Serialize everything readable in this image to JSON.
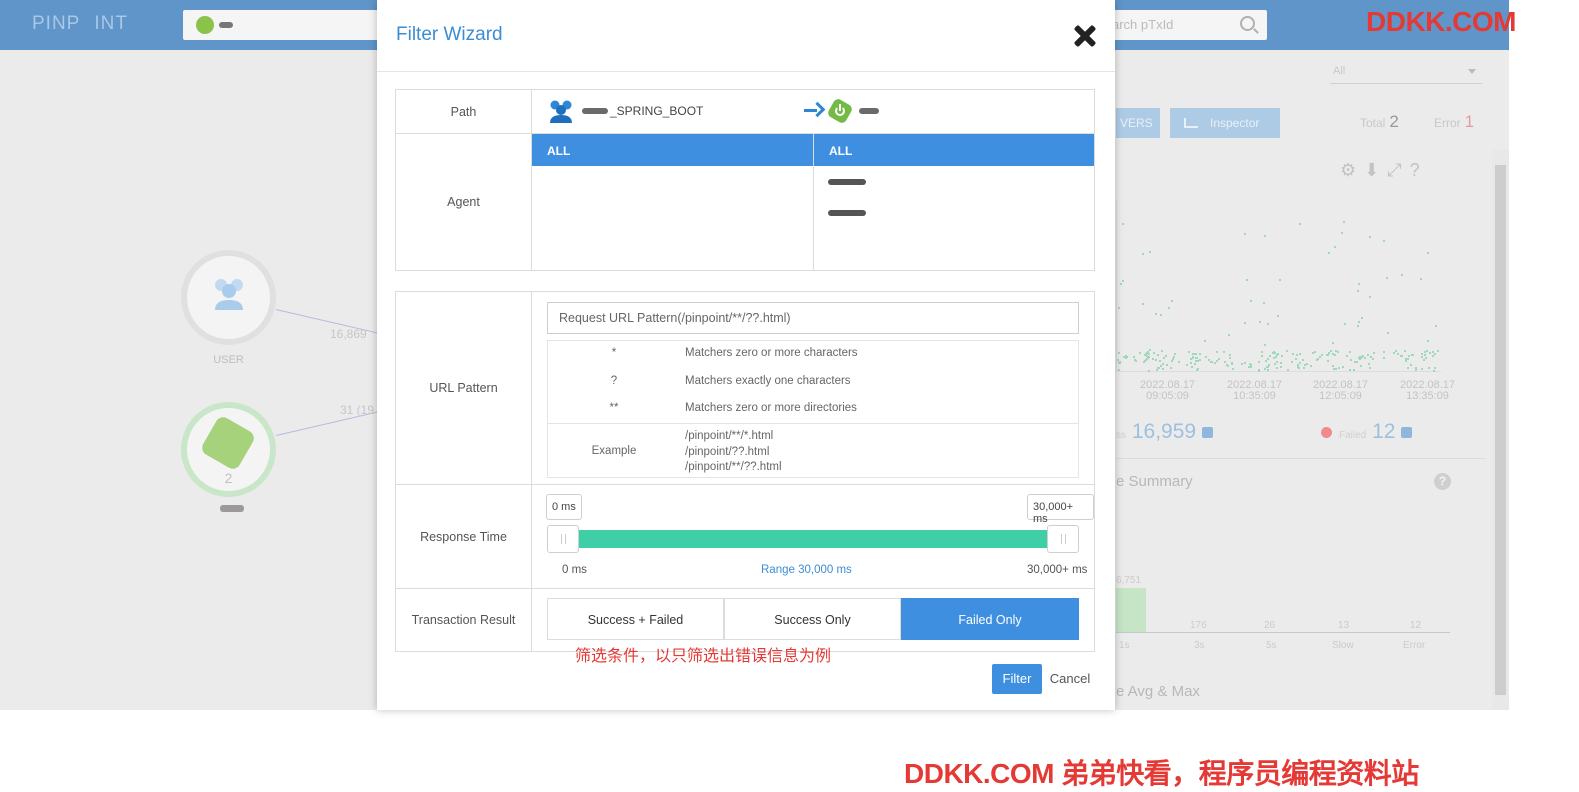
{
  "background": {
    "brand_words": [
      "PINP",
      "INT"
    ],
    "search_placeholder": "arch pTxId",
    "edge_labels": [
      "16,869",
      "31 (19"
    ],
    "user_node_label": "USER",
    "app_node_count": "2",
    "agent_select": "All",
    "servers_btn": "VERS",
    "inspector_btn": "Inspector",
    "total_label": "Total",
    "total_value": "2",
    "error_label": "Error",
    "error_value": "1",
    "x_ticks": [
      {
        "date": "2022.08.17",
        "time": "09:05:09"
      },
      {
        "date": "2022.08.17",
        "time": "10:35:09"
      },
      {
        "date": "2022.08.17",
        "time": "12:05:09"
      },
      {
        "date": "2022.08.17",
        "time": "13:35:09"
      }
    ],
    "success_label": "ss",
    "success_count": "16,959",
    "failed_label": "Failed",
    "failed_count": "12",
    "summary_title": "e Summary",
    "summary_bar_top_label": "6,751",
    "summary_values": [
      "176",
      "26",
      "13",
      "12"
    ],
    "summary_cats": [
      "1s",
      "3s",
      "5s",
      "Slow",
      "Error"
    ],
    "avgmax_title": "e Avg & Max"
  },
  "modal": {
    "title": "Filter Wizard",
    "path_label": "Path",
    "path_source_suffix": "_SPRING_BOOT",
    "agent_label": "Agent",
    "agent_all_left": "ALL",
    "agent_all_right": "ALL",
    "url_label": "URL Pattern",
    "url_placeholder": "Request URL Pattern(/pinpoint/**/??.html)",
    "url_help": [
      {
        "sym": "*",
        "desc": "Matchers zero or more characters"
      },
      {
        "sym": "?",
        "desc": "Matchers exactly one characters"
      },
      {
        "sym": "**",
        "desc": "Matchers zero or more directories"
      }
    ],
    "example_label": "Example",
    "examples": [
      "/pinpoint/**/*.html",
      "/pinpoint/??.html",
      "/pinpoint/**/??.html"
    ],
    "rt_label": "Response Time",
    "rt_min_tag": "0 ms",
    "rt_max_tag": "30,000+ ms",
    "rt_min": "0 ms",
    "rt_range": "Range 30,000 ms",
    "rt_max": "30,000+ ms",
    "tr_label": "Transaction Result",
    "tr_options": [
      "Success + Failed",
      "Success Only",
      "Failed Only"
    ],
    "tr_selected": 2,
    "annotation": "筛选条件，以只筛选出错误信息为例",
    "filter_btn": "Filter",
    "cancel_btn": "Cancel"
  },
  "watermark": {
    "top": "DDKK.COM",
    "bottom": "DDKK.COM 弟弟快看，程序员编程资料站"
  },
  "colors": {
    "accent": "#3e8fe0",
    "slider": "#3ecfa6",
    "annotation": "#e53935"
  }
}
